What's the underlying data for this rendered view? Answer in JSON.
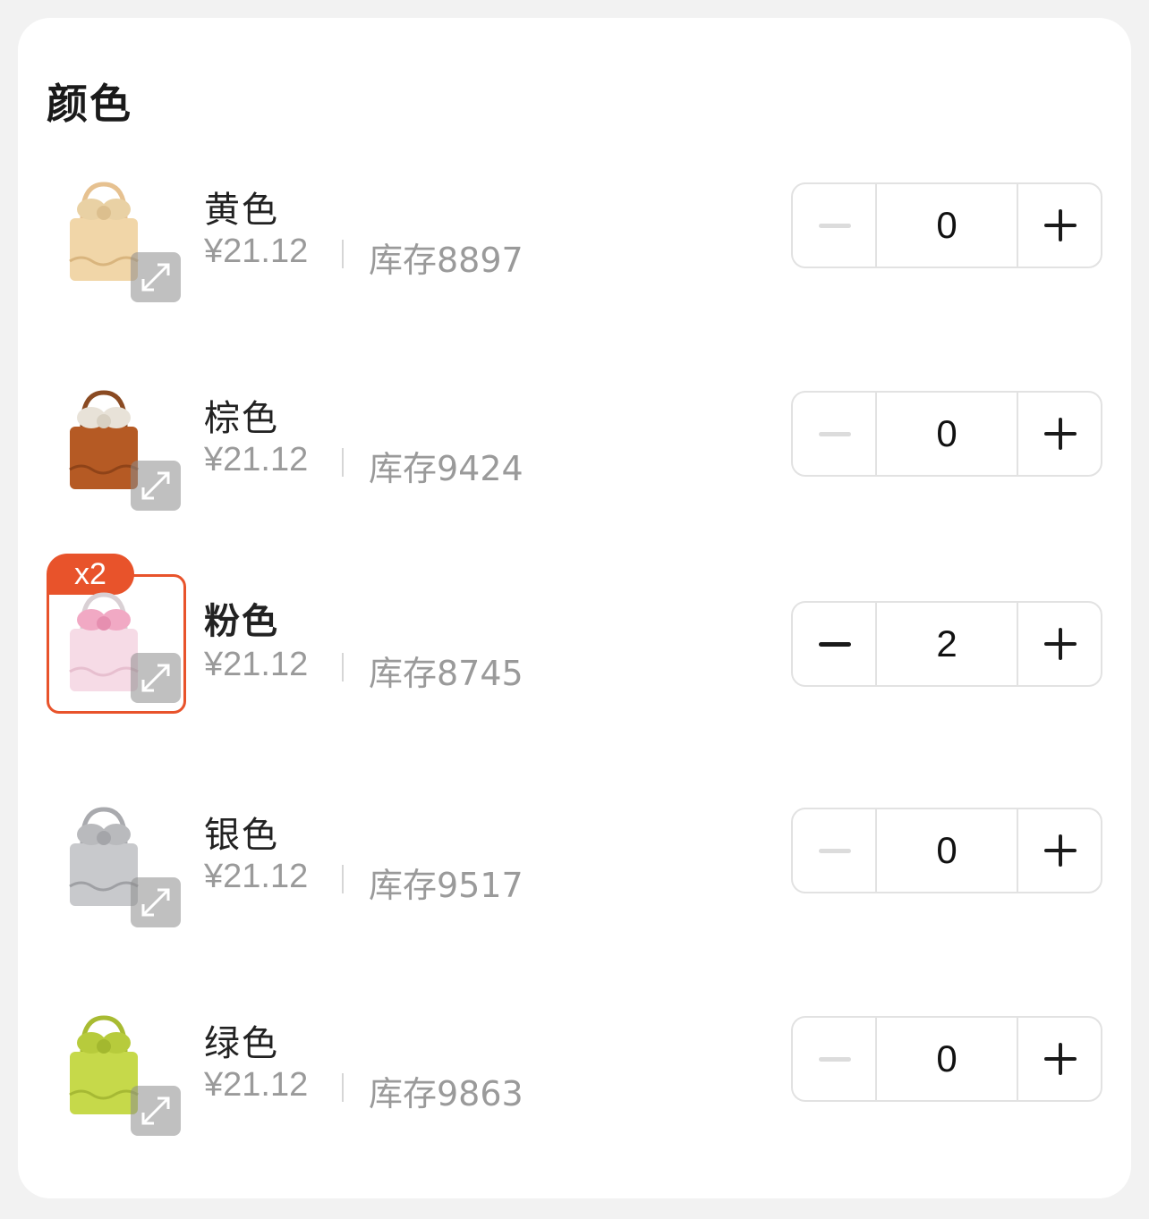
{
  "section": {
    "title": "颜色"
  },
  "colors": {
    "yellow": "#f1d6a8",
    "brown": "#b55a24",
    "pink": "#f1a9c4",
    "silver": "#c8c9cc",
    "green": "#c6d94a",
    "accent": "#e8532b"
  },
  "items": [
    {
      "name": "黄色",
      "price": "¥21.12",
      "stock": "库存8897",
      "quantity": "0",
      "selected": false,
      "icon": "bag-yellow-icon"
    },
    {
      "name": "棕色",
      "price": "¥21.12",
      "stock": "库存9424",
      "quantity": "0",
      "selected": false,
      "icon": "bag-brown-icon"
    },
    {
      "name": "粉色",
      "price": "¥21.12",
      "stock": "库存8745",
      "quantity": "2",
      "selected": true,
      "badge": "x2",
      "icon": "bag-pink-icon"
    },
    {
      "name": "银色",
      "price": "¥21.12",
      "stock": "库存9517",
      "quantity": "0",
      "selected": false,
      "icon": "bag-silver-icon"
    },
    {
      "name": "绿色",
      "price": "¥21.12",
      "stock": "库存9863",
      "quantity": "0",
      "selected": false,
      "icon": "bag-green-icon"
    }
  ]
}
